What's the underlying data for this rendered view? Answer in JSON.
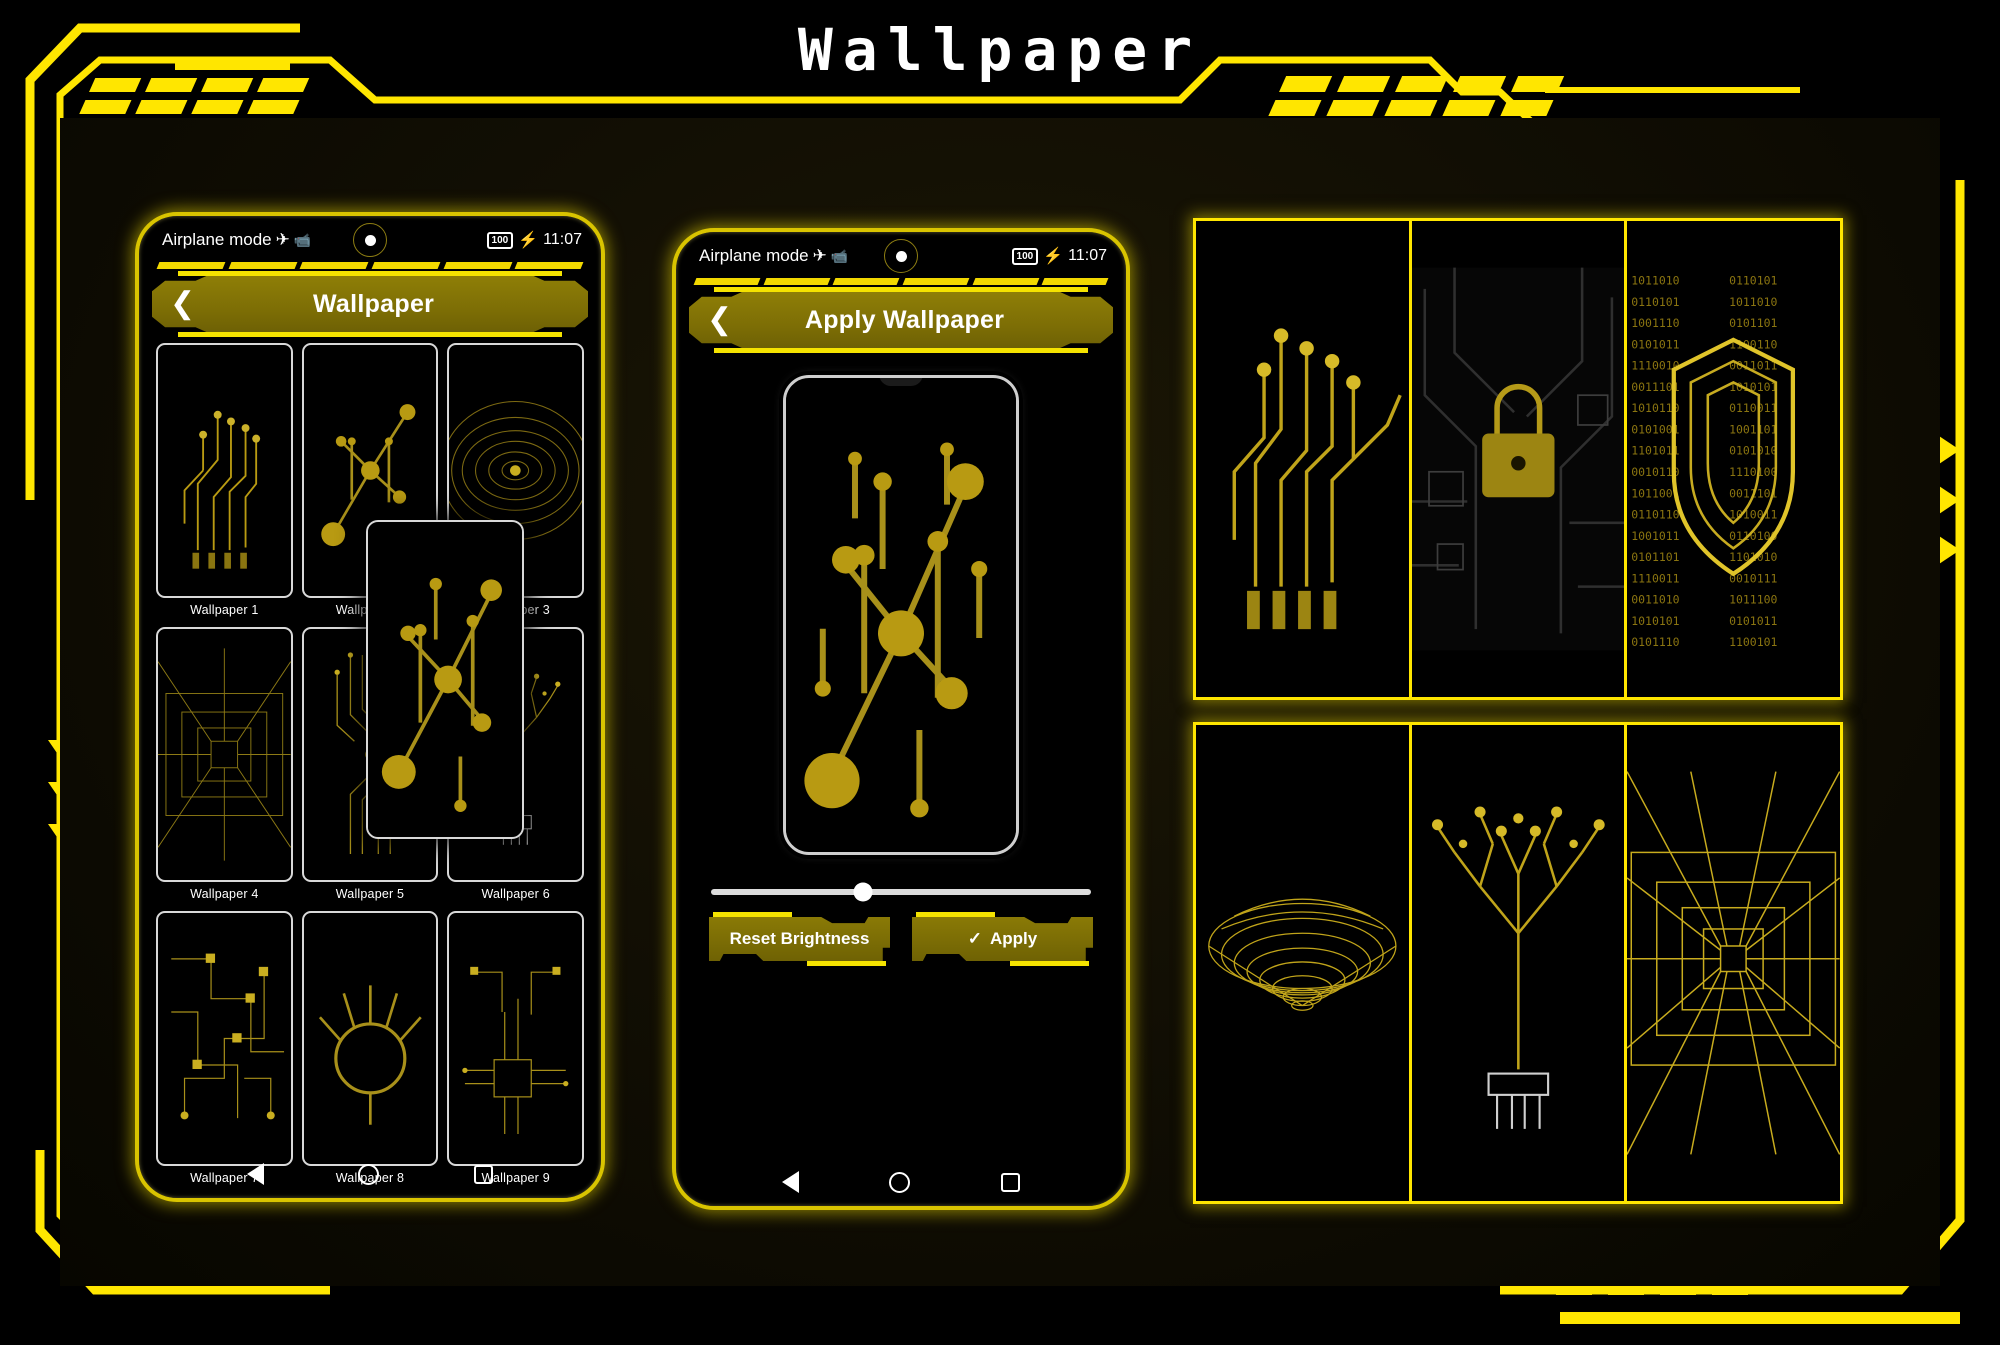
{
  "page": {
    "title": "Wallpaper",
    "theme": {
      "accent": "#ffe600",
      "accent_dark": "#8a7a06",
      "background": "#000000",
      "panel": "#140f03"
    }
  },
  "phone_left": {
    "status_bar": {
      "left_text": "Airplane mode",
      "airplane_icon": "airplane-icon",
      "camera_icon": "camera-icon",
      "battery": "100",
      "charging_icon": "bolt-icon",
      "time": "11:07"
    },
    "header": {
      "back_icon": "chevron-left-icon",
      "title": "Wallpaper"
    },
    "wallpapers": [
      {
        "label": "Wallpaper 1",
        "art": "circuit-hand"
      },
      {
        "label": "Wallpaper 2",
        "art": "circuit-node"
      },
      {
        "label": "Wallpaper 3",
        "art": "radial-rings"
      },
      {
        "label": "Wallpaper 4",
        "art": "tunnel-grid"
      },
      {
        "label": "Wallpaper 5",
        "art": "circuit-column"
      },
      {
        "label": "Wallpaper 6",
        "art": "circuit-tree"
      },
      {
        "label": "Wallpaper 7",
        "art": "circuit-board"
      },
      {
        "label": "Wallpaper 8",
        "art": "circle-ring"
      },
      {
        "label": "Wallpaper 9",
        "art": "circuit-chip"
      }
    ],
    "dragged_thumbnail": {
      "art": "circuit-node",
      "label": "Wallpaper 2"
    },
    "nav": {
      "back": "nav-back-triangle",
      "home": "nav-home-circle",
      "recents": "nav-recents-square"
    }
  },
  "phone_right": {
    "status_bar": {
      "left_text": "Airplane mode",
      "airplane_icon": "airplane-icon",
      "camera_icon": "camera-icon",
      "battery": "100",
      "charging_icon": "bolt-icon",
      "time": "11:07"
    },
    "header": {
      "back_icon": "chevron-left-icon",
      "title": "Apply Wallpaper"
    },
    "preview": {
      "art": "circuit-node"
    },
    "brightness_slider": {
      "value_percent": 40
    },
    "buttons": {
      "reset_label": "Reset Brightness",
      "apply_label": "Apply",
      "apply_check_icon": "check-icon"
    },
    "nav": {
      "back": "nav-back-triangle",
      "home": "nav-home-circle",
      "recents": "nav-recents-square"
    }
  },
  "gallery": {
    "row1": [
      {
        "art": "circuit-hand"
      },
      {
        "art": "lock-circuit"
      },
      {
        "art": "binary-shield"
      }
    ],
    "row2": [
      {
        "art": "wire-vortex"
      },
      {
        "art": "circuit-tree"
      },
      {
        "art": "laser-tunnel"
      }
    ]
  }
}
